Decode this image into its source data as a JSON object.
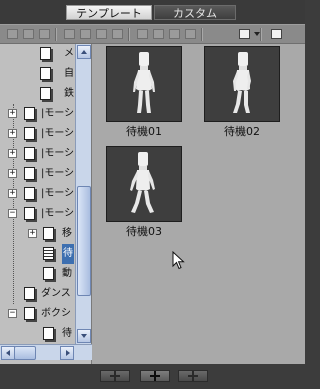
{
  "tabs": [
    {
      "label": "テンプレート",
      "active": true
    },
    {
      "label": "カスタム",
      "active": false
    }
  ],
  "toolbar": {
    "buttons": [
      "new-folder-icon",
      "folder-icon",
      "open-folder-icon",
      "cut-icon",
      "copy-icon",
      "paste-icon",
      "delete-icon",
      "save-icon",
      "camera-icon",
      "import-icon",
      "export-icon",
      "view-menu-icon",
      "export-pose-icon"
    ]
  },
  "tree": {
    "rows": [
      {
        "label": "メ",
        "icon": "folder",
        "expander": ""
      },
      {
        "label": "自",
        "icon": "folder",
        "expander": ""
      },
      {
        "label": "鉄",
        "icon": "folder",
        "expander": ""
      },
      {
        "label": "|モーシ",
        "icon": "folder",
        "expander": "+"
      },
      {
        "label": "|モーシ",
        "icon": "folder",
        "expander": "+"
      },
      {
        "label": "|モーシ",
        "icon": "folder",
        "expander": "+"
      },
      {
        "label": "|モーシ",
        "icon": "folder",
        "expander": "+"
      },
      {
        "label": "|モーシ",
        "icon": "folder",
        "expander": "+"
      },
      {
        "label": "|モーシ",
        "icon": "folder",
        "expander": "−"
      },
      {
        "label": "移",
        "icon": "folder",
        "expander": "+"
      },
      {
        "label": "待",
        "icon": "motion",
        "expander": ""
      },
      {
        "label": "動",
        "icon": "folder",
        "expander": ""
      },
      {
        "label": "ダンス",
        "icon": "folder",
        "expander": ""
      },
      {
        "label": "ボクシ",
        "icon": "folder",
        "expander": "−"
      },
      {
        "label": "待",
        "icon": "folder",
        "expander": ""
      }
    ],
    "selected_index": 10
  },
  "gallery": {
    "items": [
      {
        "label": "待機01"
      },
      {
        "label": "待機02"
      },
      {
        "label": "待機03"
      }
    ]
  },
  "bottom_bar": {
    "buttons": [
      "move-up-icon",
      "add-icon",
      "move-right-icon"
    ]
  },
  "colors": {
    "content_bg": "#a9a9a9",
    "thumb_bg": "#3e3e3e",
    "tree_bg": "#bfbfbf",
    "scrollbar": "#c9d6ea",
    "selection": "#3d6fb0"
  }
}
